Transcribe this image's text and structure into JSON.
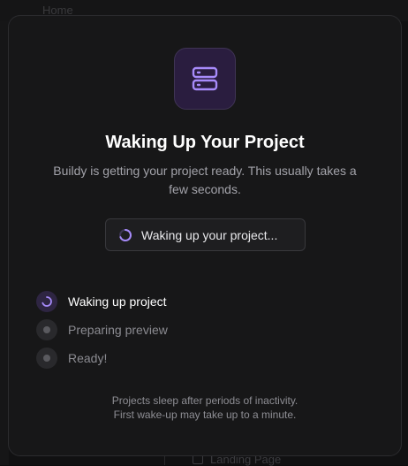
{
  "background": {
    "breadcrumbs": [
      "Home"
    ],
    "bottom_item_label": "Landing Page"
  },
  "modal": {
    "icon": "server-icon",
    "title": "Waking Up Your Project",
    "subtitle": "Buildy is getting your project ready. This usually takes a few seconds.",
    "status_label": "Waking up your project...",
    "steps": [
      {
        "label": "Waking up project",
        "state": "active"
      },
      {
        "label": "Preparing preview",
        "state": "pending"
      },
      {
        "label": "Ready!",
        "state": "pending"
      }
    ],
    "footnote_line1": "Projects sleep after periods of inactivity.",
    "footnote_line2": "First wake-up may take up to a minute."
  },
  "colors": {
    "accent": "#a78bfa",
    "tile_background": "#2a1d3f",
    "modal_background": "#171718"
  }
}
